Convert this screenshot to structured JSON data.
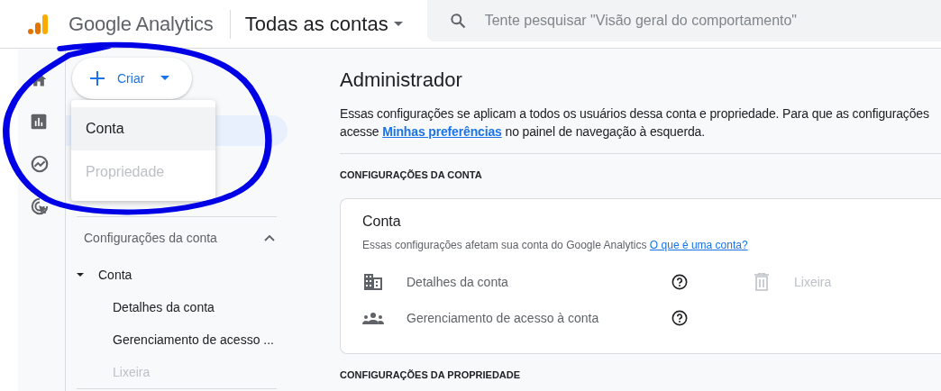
{
  "header": {
    "product": "Google Analytics",
    "account_picker": "Todas as contas",
    "search": {
      "placeholder": "Tente pesquisar \"Visão geral do comportamento\""
    }
  },
  "rail": [
    {
      "kind": "home"
    },
    {
      "kind": "reports"
    },
    {
      "kind": "explore"
    },
    {
      "kind": "advertising"
    }
  ],
  "create_button": {
    "label": "Criar"
  },
  "create_menu": [
    {
      "label": "Conta",
      "selected": true,
      "disabled": false
    },
    {
      "label": "Propriedade",
      "selected": false,
      "disabled": true
    }
  ],
  "sidebar": {
    "section": {
      "label": "Configurações da conta",
      "expanded": true,
      "items": [
        {
          "label": "Conta",
          "expanded": true,
          "children": [
            {
              "label": "Detalhes da conta",
              "disabled": false
            },
            {
              "label": "Gerenciamento de acesso ...",
              "disabled": false
            },
            {
              "label": "Lixeira",
              "disabled": true
            }
          ]
        }
      ]
    }
  },
  "main": {
    "title": "Administrador",
    "description": {
      "line_1": "Essas configurações se aplicam a todos os usuários dessa conta e propriedade. Para que as configurações",
      "line_2_start": "acesse",
      "link": "Minhas preferências",
      "line_2_end": "no painel de navegação à esquerda."
    },
    "account_section": {
      "heading": "CONFIGURAÇÕES DA CONTA",
      "card": {
        "title": "Conta",
        "text": "Essas configurações afetam sua conta do Google Analytics",
        "link": "O que é uma conta?",
        "rows": [
          {
            "kind": "details",
            "label": "Detalhes da conta",
            "action": {
              "label": "Lixeira",
              "disabled": true
            }
          },
          {
            "kind": "access",
            "label": "Gerenciamento de acesso à conta"
          }
        ]
      }
    },
    "property_section": {
      "heading": "CONFIGURAÇÕES DA PROPRIEDADE"
    }
  }
}
